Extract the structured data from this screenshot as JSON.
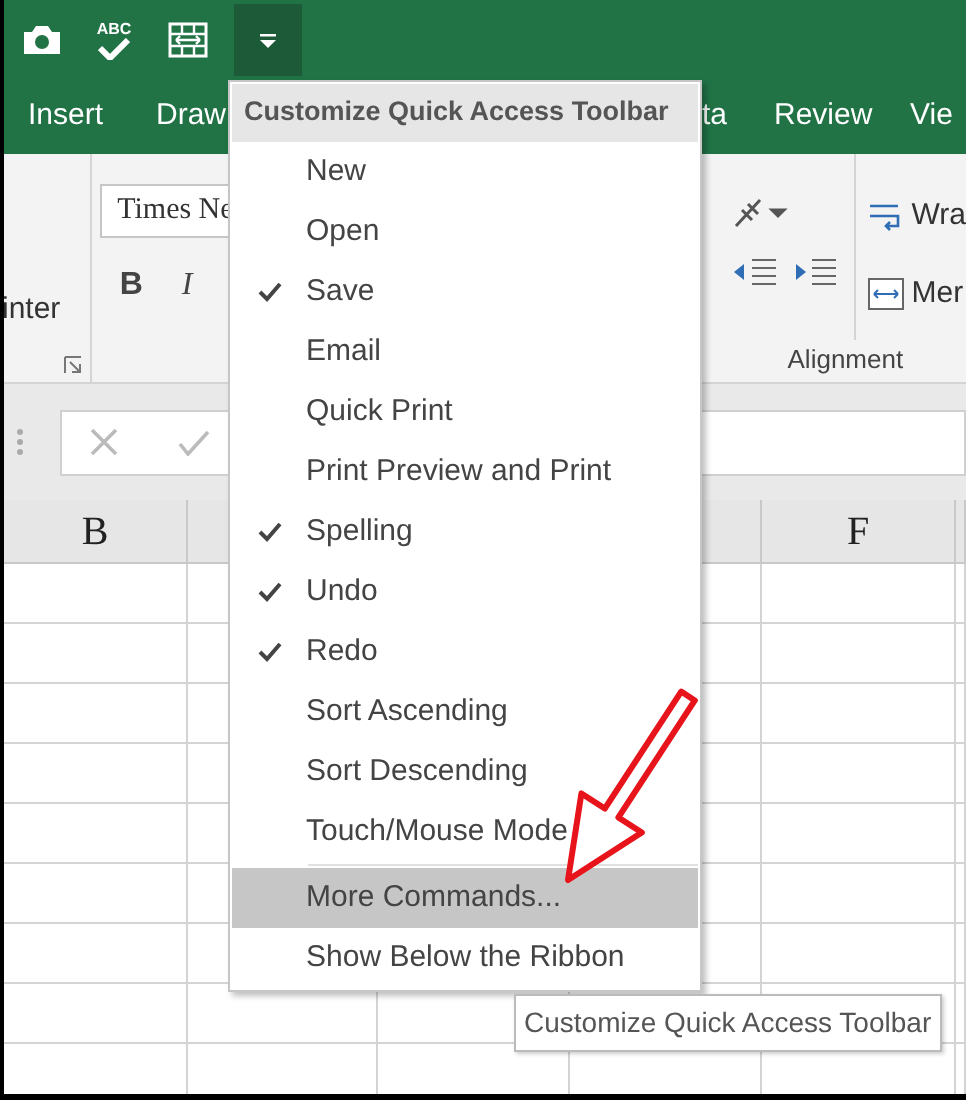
{
  "quick_access_toolbar": {
    "buttons": [
      {
        "kind": "camera"
      },
      {
        "kind": "spelling",
        "icon_text": "ABC"
      },
      {
        "kind": "merge"
      },
      {
        "kind": "dropdown",
        "selected": true
      }
    ]
  },
  "ribbon_tabs": [
    {
      "label": "Insert"
    },
    {
      "label": "Draw"
    },
    {
      "label": "ta"
    },
    {
      "label": "Review"
    },
    {
      "label": "Vie"
    }
  ],
  "ribbon": {
    "clipboard_label": "inter",
    "font_box": "Times Ne",
    "font_buttons": [
      "B",
      "I"
    ],
    "wrap_text": "Wra",
    "merge_text": "Mer",
    "group_label": "Alignment"
  },
  "column_headers": {
    "first": "B",
    "last": "F"
  },
  "menu": {
    "title": "Customize Quick Access Toolbar",
    "items": [
      {
        "label": "New",
        "kind": "toggle",
        "checked": false,
        "highlighted": false
      },
      {
        "label": "Open",
        "kind": "toggle",
        "checked": false,
        "highlighted": false
      },
      {
        "label": "Save",
        "kind": "toggle",
        "checked": true,
        "highlighted": false
      },
      {
        "label": "Email",
        "kind": "toggle",
        "checked": false,
        "highlighted": false
      },
      {
        "label": "Quick Print",
        "kind": "toggle",
        "checked": false,
        "highlighted": false
      },
      {
        "label": "Print Preview and Print",
        "kind": "toggle",
        "checked": false,
        "highlighted": false
      },
      {
        "label": "Spelling",
        "kind": "toggle",
        "checked": true,
        "highlighted": false
      },
      {
        "label": "Undo",
        "kind": "toggle",
        "checked": true,
        "highlighted": false
      },
      {
        "label": "Redo",
        "kind": "toggle",
        "checked": true,
        "highlighted": false
      },
      {
        "label": "Sort Ascending",
        "kind": "toggle",
        "checked": false,
        "highlighted": false
      },
      {
        "label": "Sort Descending",
        "kind": "toggle",
        "checked": false,
        "highlighted": false
      },
      {
        "label": "Touch/Mouse Mode",
        "kind": "toggle",
        "checked": false,
        "highlighted": false
      },
      {
        "label": "More Commands...",
        "kind": "command",
        "highlighted": true
      },
      {
        "label": "Show Below the Ribbon",
        "kind": "command",
        "highlighted": false
      }
    ]
  },
  "tooltip": {
    "text": "Customize Quick Access Toolbar"
  }
}
